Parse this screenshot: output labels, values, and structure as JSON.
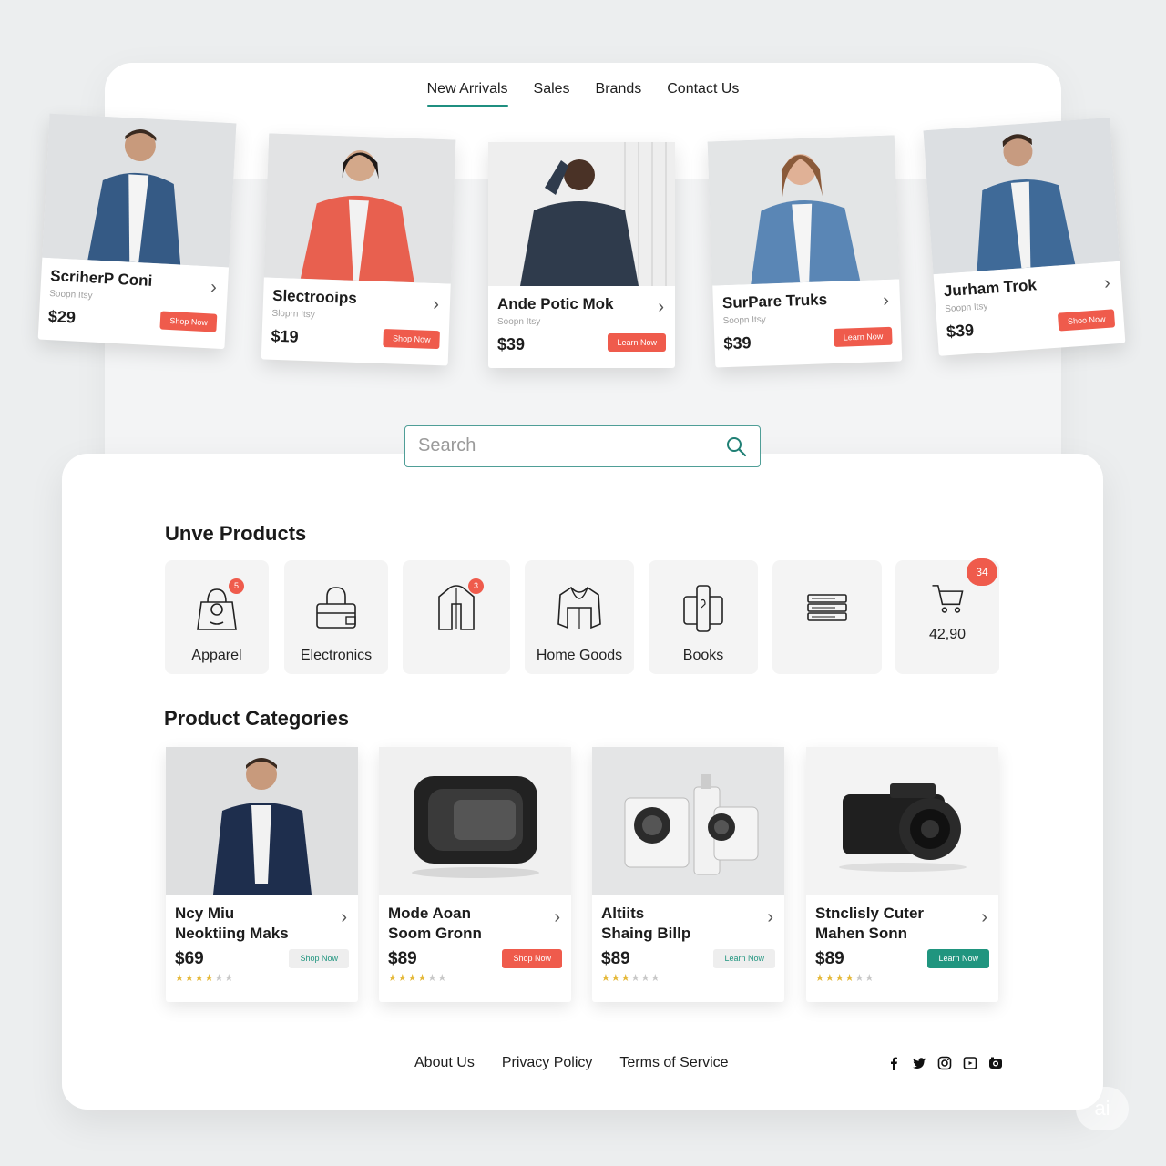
{
  "nav": {
    "items": [
      {
        "label": "New Arrivals",
        "active": true
      },
      {
        "label": "Sales",
        "active": false
      },
      {
        "label": "Brands",
        "active": false
      },
      {
        "label": "Contact Us",
        "active": false
      }
    ]
  },
  "featured": [
    {
      "name": "ScriherP Coni",
      "sub": "Soopn Itsy",
      "price": "$29",
      "button": "Shop Now"
    },
    {
      "name": "Slectrooips",
      "sub": "Sloprn Itsy",
      "price": "$19",
      "button": "Shop Now"
    },
    {
      "name": "Ande Potic Mok",
      "sub": "Soopn Itsy",
      "price": "$39",
      "button": "Learn Now"
    },
    {
      "name": "SurPare Truks",
      "sub": "Soopn Itsy",
      "price": "$39",
      "button": "Learn Now"
    },
    {
      "name": "Jurham Trok",
      "sub": "Soopn Itsy",
      "price": "$39",
      "button": "Shoo Now"
    }
  ],
  "search": {
    "placeholder": "Search",
    "value": ""
  },
  "unve": {
    "title": "Unve Products",
    "tiles": [
      {
        "label": "Apparel",
        "icon": "bag-icon",
        "badge": "5"
      },
      {
        "label": "Electronics",
        "icon": "lock-bag-icon",
        "badge": ""
      },
      {
        "label": "",
        "icon": "jacket-icon",
        "badge": "3"
      },
      {
        "label": "Home Goods",
        "icon": "hoodie-icon",
        "badge": ""
      },
      {
        "label": "Books",
        "icon": "book-icon",
        "badge": ""
      },
      {
        "label": "",
        "icon": "stack-icon",
        "badge": ""
      },
      {
        "label": "42,90",
        "icon": "cart-icon",
        "badge": "34"
      }
    ]
  },
  "categories": {
    "title": "Product Categories",
    "cards": [
      {
        "line1": "Ncy Miu",
        "line2": "Neoktiing Maks",
        "price": "$69",
        "button": "Shop Now",
        "button_style": "gray",
        "rating": 4
      },
      {
        "line1": "Mode Aoan",
        "line2": "Soom Gronn",
        "price": "$89",
        "button": "Shop Now",
        "button_style": "red",
        "rating": 4
      },
      {
        "line1": "Altiits",
        "line2": "Shaing Billp",
        "price": "$89",
        "button": "Learn Now",
        "button_style": "gray",
        "rating": 3
      },
      {
        "line1": "Stnclisly Cuter",
        "line2": "Mahen Sonn",
        "price": "$89",
        "button": "Learn Now",
        "button_style": "teal",
        "rating": 4
      }
    ]
  },
  "footer": {
    "links": [
      "About Us",
      "Privacy Policy",
      "Terms of Service"
    ],
    "socials": [
      "facebook-icon",
      "twitter-icon",
      "instagram-icon",
      "youtube-icon",
      "camera-icon"
    ]
  },
  "corner": {
    "label": "ai"
  },
  "colors": {
    "accent": "#20957f",
    "cta": "#ef5b4c",
    "star": "#e5b93a"
  }
}
